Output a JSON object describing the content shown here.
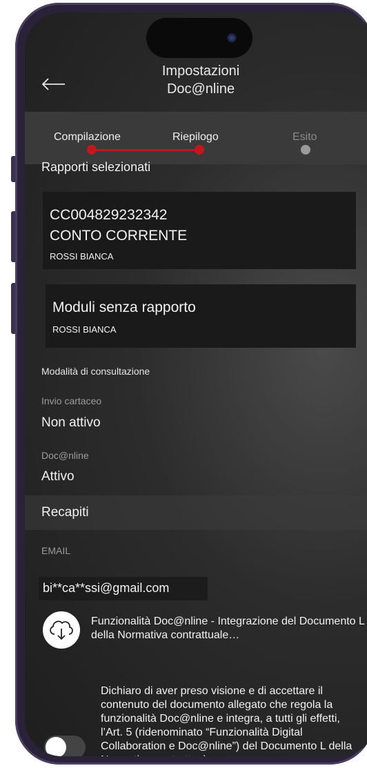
{
  "header": {
    "title_line1": "Impostazioni",
    "title_line2": "Doc@nline",
    "back_icon": "arrow-left-icon"
  },
  "stepper": {
    "steps": [
      {
        "label": "Compilazione",
        "state": "done"
      },
      {
        "label": "Riepilogo",
        "state": "current"
      },
      {
        "label": "Esito",
        "state": "pending"
      }
    ],
    "active_color": "#c4161c",
    "inactive_color": "#9a9a9a"
  },
  "selected_reports": {
    "title": "Rapporti selezionati",
    "items": [
      {
        "code": "CC004829232342",
        "type": "CONTO CORRENTE",
        "holder": "ROSSI BIANCA"
      },
      {
        "code": "Moduli senza rapporto",
        "holder": "ROSSI BIANCA"
      }
    ]
  },
  "consultation": {
    "title": "Modalità di consultazione",
    "paper_label": "Invio cartaceo",
    "paper_value": "Non attivo",
    "online_label": "Doc@nline",
    "online_value": "Attivo"
  },
  "contacts": {
    "title": "Recapiti",
    "email_label": "EMAIL",
    "email_value": "bi**ca**ssi@gmail.com"
  },
  "document": {
    "icon": "cloud-download-icon",
    "link_text": "Funzionalità Doc@nline - Integrazione del Documento L della Normativa contrattuale…"
  },
  "consent": {
    "text": "Dichiaro di aver preso visione e di accettare il contenuto del documento allegato che regola la funzionalità Doc@nline e integra, a tutti gli effetti, l’Art. 5 (ridenominato “Funzionalità Digital Collaboration e Doc@nline”) del Documento L della Normativa contrattual",
    "toggle_on": false
  }
}
